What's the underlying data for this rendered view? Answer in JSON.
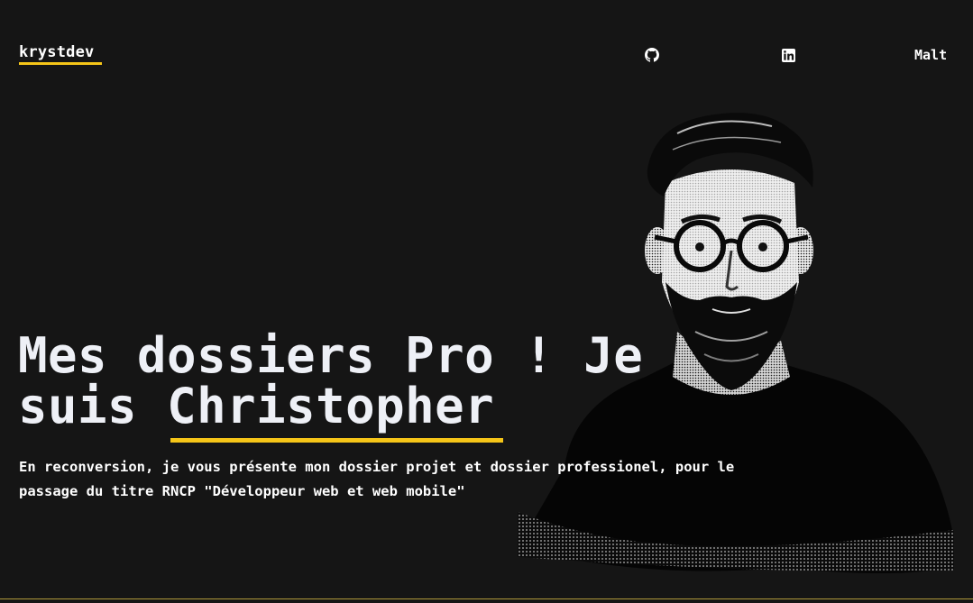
{
  "header": {
    "logo": "krystdev",
    "nav": [
      {
        "label": "",
        "icon": "github-icon"
      },
      {
        "label": "",
        "icon": "linkedin-icon"
      },
      {
        "label": "Malt",
        "icon": ""
      }
    ]
  },
  "hero": {
    "title_line1": "Mes dossiers Pro ! Je",
    "title_line2_prefix": "suis ",
    "title_name": "Christopher",
    "description": "En reconversion, je vous présente mon dossier projet et dossier professionel, pour le passage du titre RNCP \"Développeur web et web mobile\""
  },
  "colors": {
    "background": "#151515",
    "accent": "#f5c518",
    "text": "#ffffff"
  }
}
